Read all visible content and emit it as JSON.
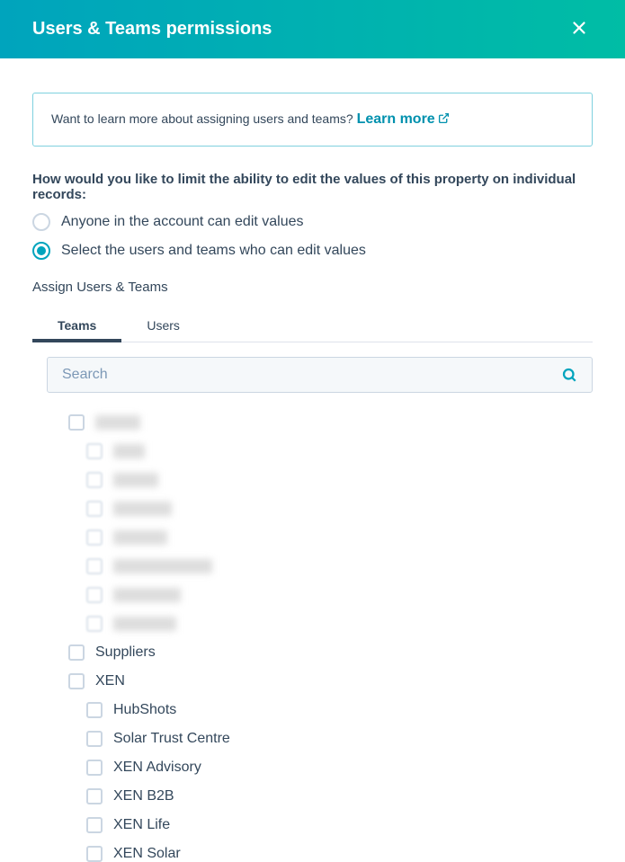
{
  "header": {
    "title": "Users & Teams permissions"
  },
  "info_box": {
    "text": "Want to learn more about assigning users and teams? ",
    "link_text": "Learn more"
  },
  "question": "How would you like to limit the ability to edit the values of this property on individual records:",
  "radio_options": {
    "anyone": "Anyone in the account can edit values",
    "select": "Select the users and teams who can edit values"
  },
  "assign_label": "Assign Users & Teams",
  "tabs": {
    "teams": "Teams",
    "users": "Users"
  },
  "search": {
    "placeholder": "Search"
  },
  "teams": {
    "suppliers": "Suppliers",
    "xen": "XEN",
    "xen_children": {
      "hubshots": "HubShots",
      "solar_trust": "Solar Trust Centre",
      "xen_advisory": "XEN Advisory",
      "xen_b2b": "XEN B2B",
      "xen_life": "XEN Life",
      "xen_solar": "XEN Solar"
    }
  }
}
